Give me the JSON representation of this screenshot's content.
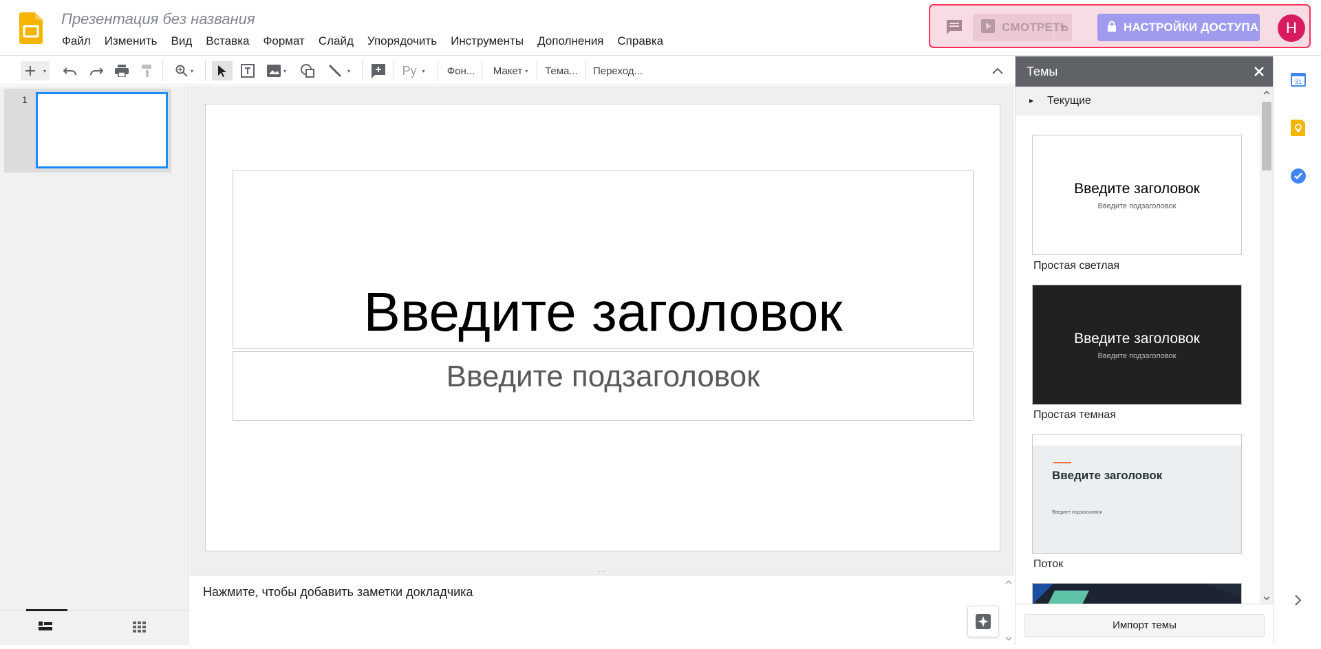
{
  "header": {
    "doc_title": "Презентация без названия",
    "menu": [
      "Файл",
      "Изменить",
      "Вид",
      "Вставка",
      "Формат",
      "Слайд",
      "Упорядочить",
      "Инструменты",
      "Дополнения",
      "Справка"
    ],
    "present_label": "СМОТРЕТЬ",
    "share_label": "НАСТРОЙКИ ДОСТУПА",
    "avatar_initial": "Н"
  },
  "toolbar": {
    "spelling": "Ру",
    "background": "Фон...",
    "layout": "Макет",
    "theme": "Тема...",
    "transition": "Переход..."
  },
  "filmstrip": {
    "slide_number": "1"
  },
  "slide": {
    "title_placeholder": "Введите заголовок",
    "subtitle_placeholder": "Введите подзаголовок"
  },
  "notes": {
    "placeholder": "Нажмите, чтобы добавить заметки докладчика"
  },
  "themes": {
    "panel_title": "Темы",
    "current_label": "Текущие",
    "items": [
      {
        "name": "Простая светлая",
        "title": "Введите заголовок",
        "subtitle": "Введите подзаголовок",
        "bg": "#ffffff",
        "fg": "#000000",
        "sub_fg": "#595959"
      },
      {
        "name": "Простая темная",
        "title": "Введите заголовок",
        "subtitle": "Введите подзаголовок",
        "bg": "#212121",
        "fg": "#ffffff",
        "sub_fg": "#bdbdbd"
      },
      {
        "name": "Поток",
        "title": "Введите заголовок",
        "subtitle": "Введите подзаголовок",
        "bg": "#eceff1",
        "fg": "#263238",
        "sub_fg": "#455a64"
      }
    ],
    "import_label": "Импорт темы"
  },
  "colors": {
    "accent_blue": "#1a8cff",
    "share_button": "#9f9cf0",
    "avatar": "#d81b60",
    "highlight_border": "#ff2d55"
  },
  "icons": [
    "slides-logo-icon",
    "comment-icon",
    "present-icon",
    "lock-icon",
    "new-slide-icon",
    "undo-icon",
    "redo-icon",
    "print-icon",
    "paint-format-icon",
    "zoom-icon",
    "select-icon",
    "text-box-icon",
    "image-icon",
    "shape-icon",
    "line-icon",
    "add-comment-icon",
    "collapse-icon",
    "close-icon",
    "explore-icon",
    "calendar-icon",
    "keep-icon",
    "tasks-icon",
    "expand-side-icon"
  ]
}
